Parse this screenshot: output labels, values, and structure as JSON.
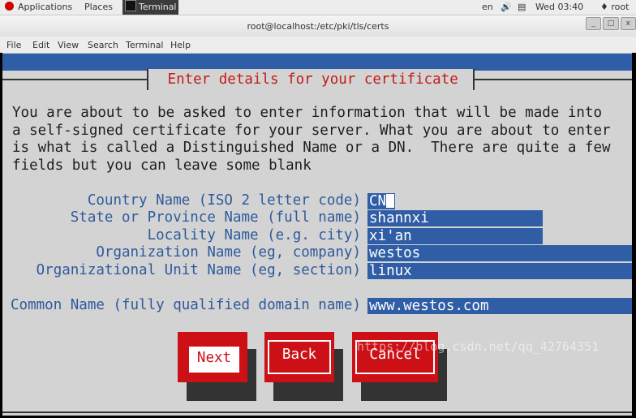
{
  "topbar": {
    "applications": "Applications",
    "places": "Places",
    "task": "Terminal",
    "locale": "en",
    "volume_icon": "volume-icon",
    "network_icon": "network-icon",
    "clock": "Wed 03:40",
    "user_icon": "user-icon",
    "user": "root"
  },
  "window": {
    "title": "root@localhost:/etc/pki/tls/certs"
  },
  "menubar": {
    "file": "File",
    "edit": "Edit",
    "view": "View",
    "search": "Search",
    "terminal": "Terminal",
    "help": "Help"
  },
  "dialog": {
    "title": " Enter details for your certificate ",
    "message": "You are about to be asked to enter information that will be made into\na self-signed certificate for your server. What you are about to enter\nis what is called a Distinguished Name or a DN.  There are quite a few\nfields but you can leave some blank",
    "fields": [
      {
        "label": "Country Name (ISO 2 letter code)",
        "value": "CN"
      },
      {
        "label": "State or Province Name (full name)",
        "value": "shannxi"
      },
      {
        "label": "Locality Name (e.g. city)",
        "value": "xi'an"
      },
      {
        "label": "Organization Name (eg, company)",
        "value": "westos"
      },
      {
        "label": "Organizational Unit Name (eg, section)",
        "value": "linux"
      },
      {
        "label": "Common Name (fully qualified domain name)",
        "value": "www.westos.com"
      }
    ],
    "buttons": {
      "next": "Next",
      "back": "Back",
      "cancel": "Cancel"
    }
  },
  "watermark": "https://blog.csdn.net/qq_42764351"
}
